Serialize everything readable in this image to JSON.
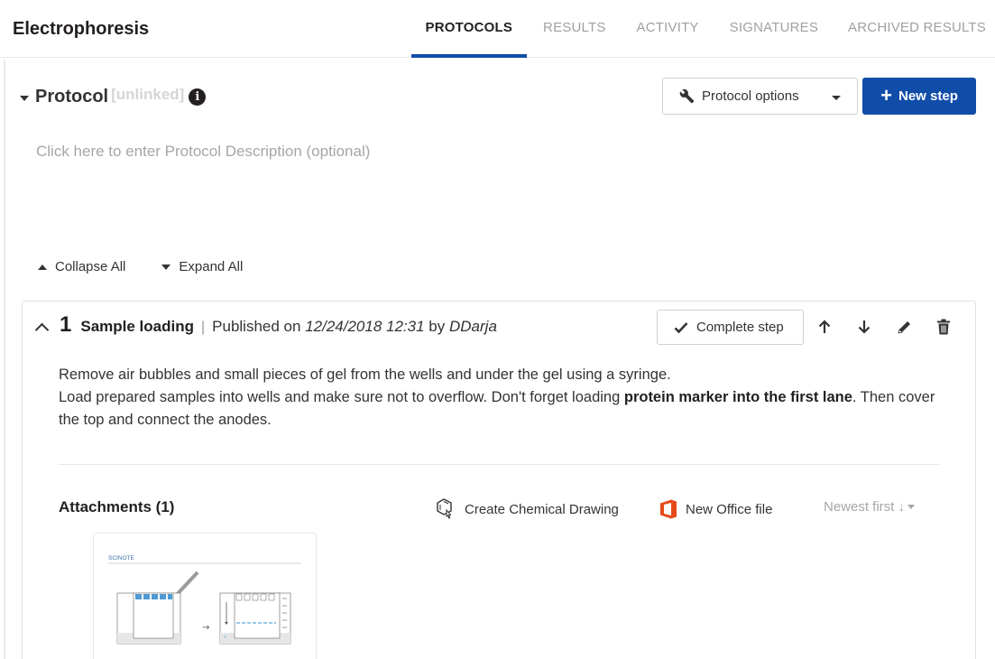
{
  "header": {
    "title": "Electrophoresis",
    "tabs": [
      {
        "label": "PROTOCOLS",
        "active": true
      },
      {
        "label": "RESULTS",
        "active": false
      },
      {
        "label": "ACTIVITY",
        "active": false
      },
      {
        "label": "SIGNATURES",
        "active": false
      },
      {
        "label": "ARCHIVED RESULTS",
        "active": false
      }
    ]
  },
  "protocol": {
    "title": "Protocol",
    "status": "[unlinked]",
    "info_icon": "i",
    "options_label": "Protocol options",
    "new_step_label": "New step",
    "description_placeholder": "Click here to enter Protocol Description (optional)",
    "collapse_all": "Collapse All",
    "expand_all": "Expand All"
  },
  "step": {
    "number": "1",
    "name": "Sample loading",
    "separator": "|",
    "published_prefix": "Published on",
    "published_date": "12/24/2018 12:31",
    "by": "by",
    "author": "DDarja",
    "complete_label": "Complete step",
    "body_line1": "Remove air bubbles and small pieces of gel from the wells and under the gel using a syringe.",
    "body_line2_start": "Load prepared samples into wells and make sure not to overflow. Don't forget loading ",
    "body_line2_bold": "protein marker into the first lane",
    "body_line2_end": ". Then cover the top and connect the anodes."
  },
  "attachments": {
    "title": "Attachments (1)",
    "chem_label": "Create Chemical Drawing",
    "office_label": "New Office file",
    "sort_label": "Newest first ↓",
    "thumb_logo": "SCINOTE"
  },
  "colors": {
    "primary": "#104da9",
    "office_red": "#e64a19",
    "muted_text": "#a6a6a6",
    "gel_blue": "#5ba4d8"
  }
}
